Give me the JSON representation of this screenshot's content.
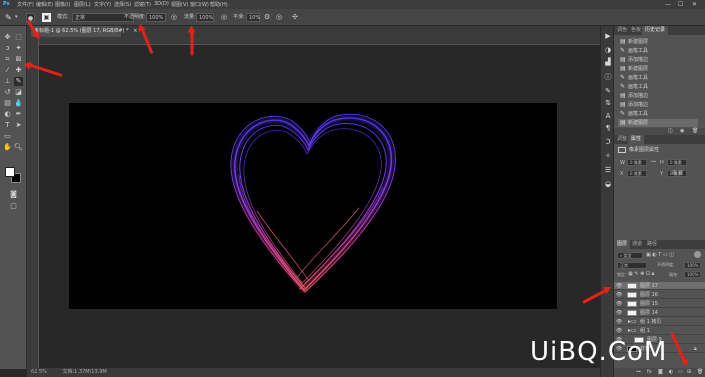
{
  "app": {
    "name": "Photoshop"
  },
  "menubar": {
    "logo": "Ps",
    "items": [
      "文件(F)",
      "编辑(E)",
      "图像(I)",
      "图层(L)",
      "文字(Y)",
      "选择(S)",
      "滤镜(T)",
      "3D(D)",
      "视图(V)",
      "窗口(W)",
      "帮助(H)"
    ],
    "window_controls": [
      "—",
      "☐",
      "✕"
    ]
  },
  "options_bar": {
    "mode_label": "模式:",
    "mode_value": "正常",
    "opacity_label": "不透明度:",
    "opacity_value": "100%",
    "flow_label": "流量:",
    "flow_value": "100%",
    "smoothing_label": "平滑:",
    "smoothing_value": "10%"
  },
  "document": {
    "tab_title": "未标题-1 @ 62.5% (图层 17, RGB/8#) *",
    "tab_close": "×"
  },
  "status_bar": {
    "zoom": "62.5%",
    "doc_info": "文档:1.37M/13.9M"
  },
  "history_panel": {
    "tabs": [
      "调色",
      "色板",
      "历史记录"
    ],
    "active_tab": 2,
    "items": [
      "新建图层",
      "画笔工具",
      "添加描边",
      "新建图层",
      "画笔工具",
      "画笔工具",
      "添加描边",
      "添加描边",
      "画笔工具",
      "新建图层"
    ]
  },
  "properties_panel": {
    "tabs": [
      "调整",
      "属性"
    ],
    "active_tab": 1,
    "title": "像素图层属性",
    "w_label": "W",
    "h_label": "H",
    "x_label": "X",
    "y_label": "Y",
    "w_value": "0 像素",
    "h_value": "0 像素",
    "x_value": "0 像素",
    "y_value": "0 像素"
  },
  "layers_panel": {
    "tabs": [
      "图层",
      "通道",
      "路径"
    ],
    "active_tab": 0,
    "filter_label": "类型",
    "blend_mode": "正常",
    "opacity_label": "不透明度:",
    "opacity_value": "100%",
    "lock_label": "锁定:",
    "fill_label": "填充:",
    "fill_value": "100%",
    "layers": [
      {
        "name": "图层 17",
        "selected": true,
        "kind": "pixel"
      },
      {
        "name": "图层 16",
        "selected": false,
        "kind": "pixel"
      },
      {
        "name": "图层 15",
        "selected": false,
        "kind": "pixel"
      },
      {
        "name": "图层 14",
        "selected": false,
        "kind": "pixel"
      },
      {
        "name": "组 1 拷贝",
        "selected": false,
        "kind": "group"
      },
      {
        "name": "组 1",
        "selected": false,
        "kind": "group"
      },
      {
        "name": "图层 9",
        "selected": false,
        "kind": "pixel"
      },
      {
        "name": "背景",
        "selected": false,
        "kind": "background"
      }
    ]
  },
  "canvas": {
    "background": "#000000",
    "heart_colors": [
      "#3b2dd8",
      "#7a3cf0",
      "#c43a9a",
      "#e64b6a"
    ]
  },
  "watermark": {
    "text": "UiBQ.CoM"
  },
  "annotation_color": "#e52218"
}
